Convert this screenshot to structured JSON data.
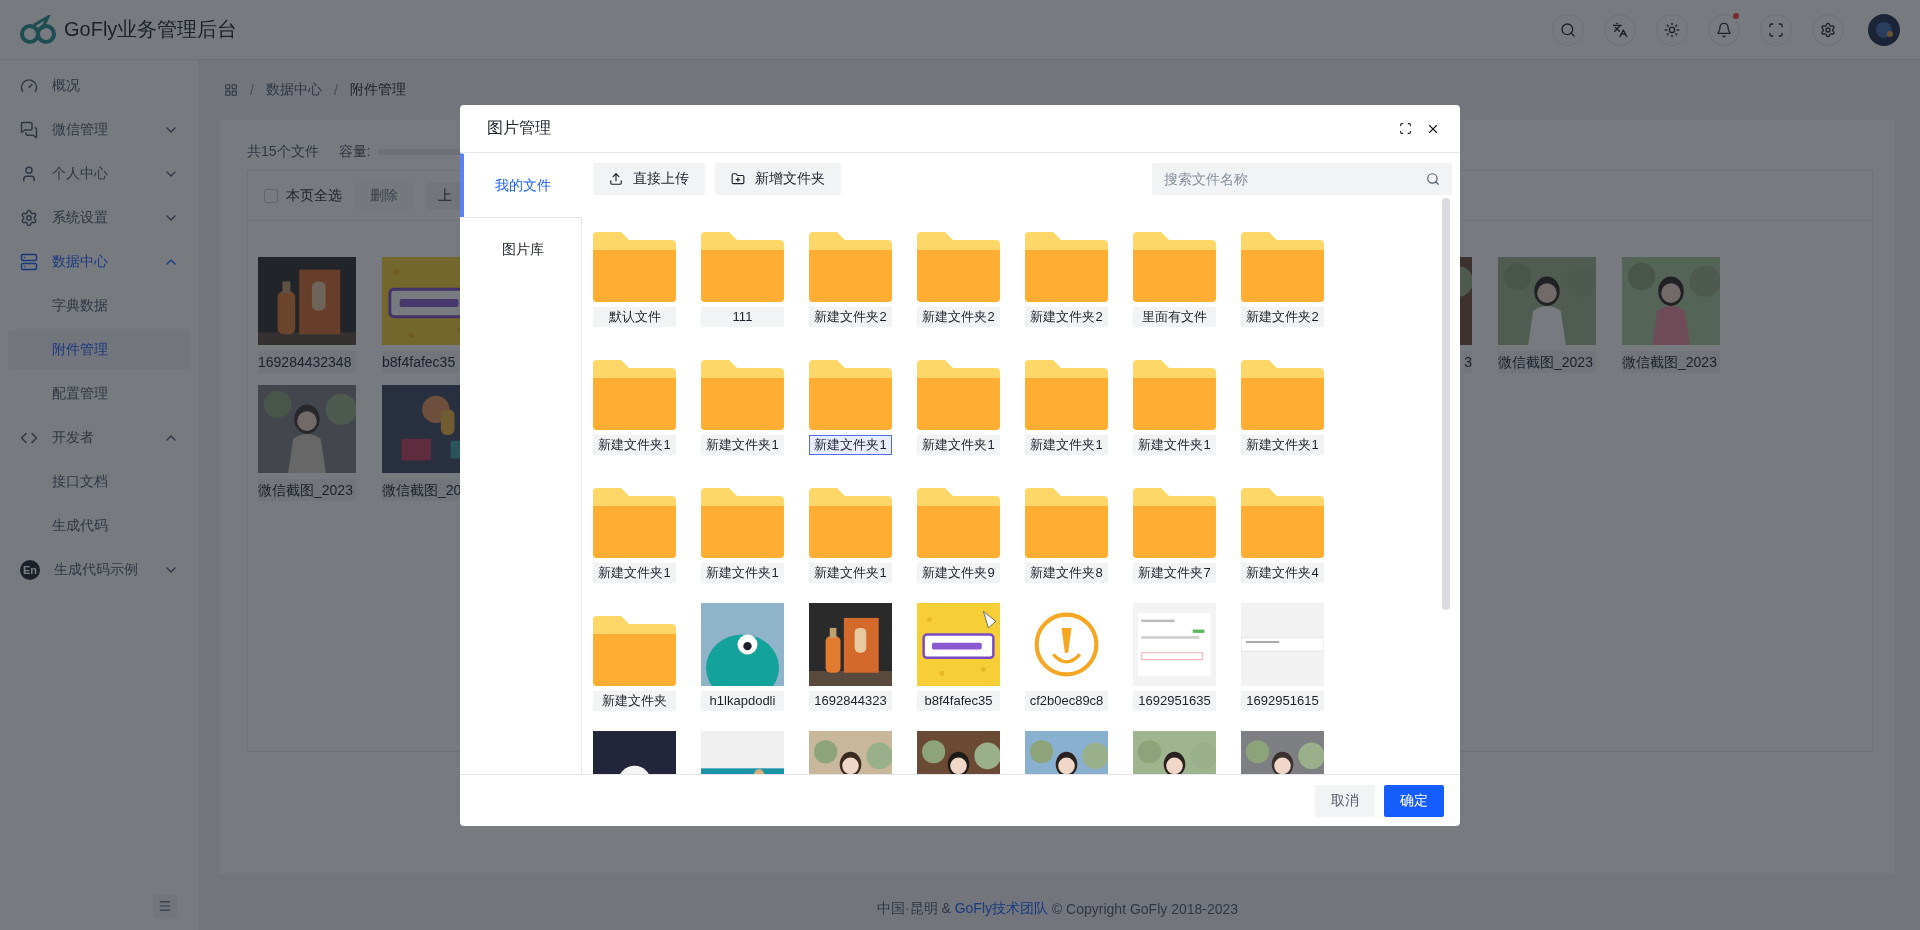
{
  "header": {
    "title": "GoFly业务管理后台",
    "notification": true
  },
  "sidebar": {
    "items": [
      {
        "label": "概况",
        "selected": false
      },
      {
        "label": "微信管理",
        "selected": false,
        "expanded": false
      },
      {
        "label": "个人中心",
        "selected": false,
        "expanded": false
      },
      {
        "label": "系统设置",
        "selected": false,
        "expanded": false
      },
      {
        "label": "数据中心",
        "selected": true,
        "expanded": true,
        "children": [
          {
            "label": "字典数据",
            "selected": false
          },
          {
            "label": "附件管理",
            "selected": true
          },
          {
            "label": "配置管理",
            "selected": false
          }
        ]
      },
      {
        "label": "开发者",
        "selected": false,
        "expanded": true,
        "children": [
          {
            "label": "接口文档",
            "selected": false
          },
          {
            "label": "生成代码",
            "selected": false
          }
        ]
      },
      {
        "label": "生成代码示例",
        "selected": false,
        "expanded": false,
        "icon_label": "En"
      }
    ]
  },
  "breadcrumb": {
    "separator": "/",
    "items": [
      "数据中心",
      "附件管理"
    ]
  },
  "attachments": {
    "summary": "共15个文件",
    "capacity_label": "容量:",
    "select_all": {
      "label": "本页全选",
      "checked": false
    },
    "delete_button": {
      "label": "删除",
      "disabled": true
    },
    "upload_button": "上",
    "files": [
      [
        {
          "label": "169284432348"
        },
        {
          "label": "b8f4fafec35"
        },
        {
          "label": "3"
        },
        {
          "label": "微信截图_2023"
        },
        {
          "label": "微信截图_2023"
        }
      ],
      [
        {
          "label": "微信截图_2023"
        },
        {
          "label": "微信截图_20"
        }
      ]
    ]
  },
  "footer": {
    "before": "中国·昆明 & ",
    "link": "GoFly技术团队",
    "after": " © Copyright GoFly 2018-2023"
  },
  "dialog": {
    "title": "图片管理",
    "tabs": [
      {
        "label": "我的文件",
        "selected": true
      },
      {
        "label": "图片库",
        "selected": false
      }
    ],
    "upload_button": "直接上传",
    "new_folder_button": "新增文件夹",
    "search": {
      "placeholder": "搜索文件名称"
    },
    "files": [
      {
        "kind": "folder",
        "label": "默认文件",
        "selected": false
      },
      {
        "kind": "folder",
        "label": "111",
        "selected": false
      },
      {
        "kind": "folder",
        "label": "新建文件夹2",
        "selected": false
      },
      {
        "kind": "folder",
        "label": "新建文件夹2",
        "selected": false
      },
      {
        "kind": "folder",
        "label": "新建文件夹2",
        "selected": false
      },
      {
        "kind": "folder",
        "label": "里面有文件",
        "selected": false
      },
      {
        "kind": "folder",
        "label": "新建文件夹2",
        "selected": false
      },
      {
        "kind": "folder",
        "label": "新建文件夹1",
        "selected": false
      },
      {
        "kind": "folder",
        "label": "新建文件夹1",
        "selected": false
      },
      {
        "kind": "folder",
        "label": "新建文件夹1",
        "selected": true
      },
      {
        "kind": "folder",
        "label": "新建文件夹1",
        "selected": false
      },
      {
        "kind": "folder",
        "label": "新建文件夹1",
        "selected": false
      },
      {
        "kind": "folder",
        "label": "新建文件夹1",
        "selected": false
      },
      {
        "kind": "folder",
        "label": "新建文件夹1",
        "selected": false
      },
      {
        "kind": "folder",
        "label": "新建文件夹1",
        "selected": false
      },
      {
        "kind": "folder",
        "label": "新建文件夹1",
        "selected": false
      },
      {
        "kind": "folder",
        "label": "新建文件夹1",
        "selected": false
      },
      {
        "kind": "folder",
        "label": "新建文件夹9",
        "selected": false
      },
      {
        "kind": "folder",
        "label": "新建文件夹8",
        "selected": false
      },
      {
        "kind": "folder",
        "label": "新建文件夹7",
        "selected": false
      },
      {
        "kind": "folder",
        "label": "新建文件夹4",
        "selected": false
      },
      {
        "kind": "folder",
        "label": "新建文件夹",
        "selected": false
      },
      {
        "kind": "picture",
        "label": "h1lkapdodli",
        "selected": false
      },
      {
        "kind": "picture",
        "label": "1692844323",
        "selected": false
      },
      {
        "kind": "picture",
        "label": "b8f4fafec35",
        "selected": false
      },
      {
        "kind": "picture",
        "label": "cf2b0ec89c8",
        "selected": false
      },
      {
        "kind": "picture",
        "label": "1692951635",
        "selected": false
      },
      {
        "kind": "picture",
        "label": "1692951615",
        "selected": false
      },
      {
        "kind": "picture"
      },
      {
        "kind": "picture"
      },
      {
        "kind": "picture"
      },
      {
        "kind": "picture"
      },
      {
        "kind": "picture"
      },
      {
        "kind": "picture"
      },
      {
        "kind": "picture"
      }
    ],
    "cancel_button": "取消",
    "confirm_button": "确定"
  }
}
